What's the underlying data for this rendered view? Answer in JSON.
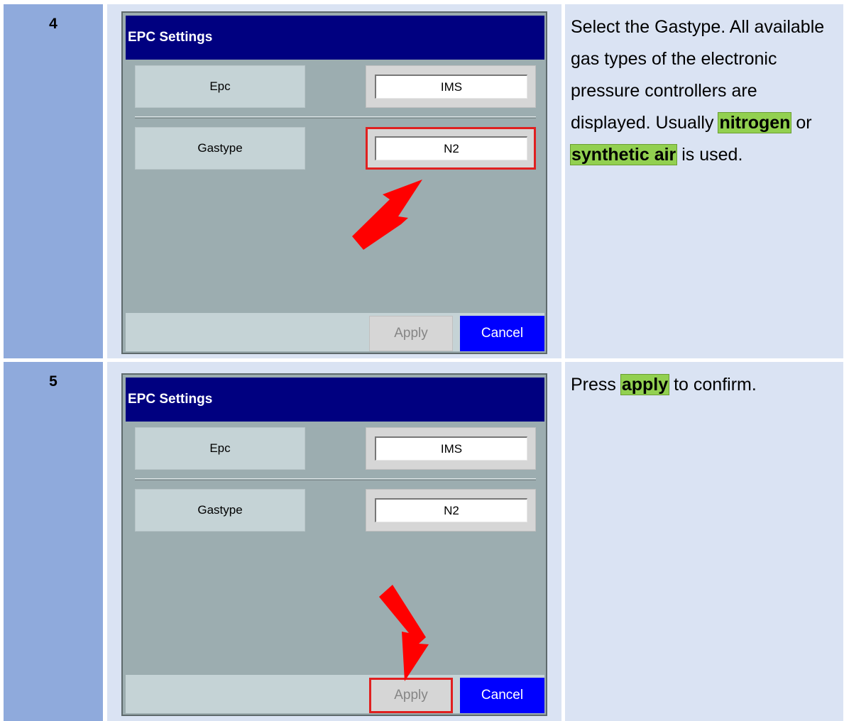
{
  "accent_colors": {
    "step_column": "#8faadc",
    "panel_background": "#dae3f3",
    "dialog_title_bar": "#000080",
    "cancel_button": "#0000ff",
    "highlight_marker": "#e02020",
    "keyword_highlight": "#92d050"
  },
  "steps": [
    {
      "number": "4",
      "dialog": {
        "title": "EPC Settings",
        "rows": [
          {
            "label": "Epc",
            "value": "IMS"
          },
          {
            "label": "Gastype",
            "value": "N2"
          }
        ],
        "apply_label": "Apply",
        "cancel_label": "Cancel"
      },
      "annotation": {
        "arrow_icon": "red-arrow-icon",
        "highlighted": "gastype-field"
      },
      "description": {
        "text1": "Select the Gastype. All available gas types of the electronic pressure controllers are displayed. Usually ",
        "highlight1": "nitrogen",
        "text2": " or ",
        "highlight2": "synthetic air",
        "text3": " is used."
      }
    },
    {
      "number": "5",
      "dialog": {
        "title": "EPC Settings",
        "rows": [
          {
            "label": "Epc",
            "value": "IMS"
          },
          {
            "label": "Gastype",
            "value": "N2"
          }
        ],
        "apply_label": "Apply",
        "cancel_label": "Cancel"
      },
      "annotation": {
        "arrow_icon": "red-arrow-icon",
        "highlighted": "apply-button"
      },
      "description": {
        "text1": "Press ",
        "highlight1": "apply",
        "text2": " to confirm."
      }
    }
  ]
}
